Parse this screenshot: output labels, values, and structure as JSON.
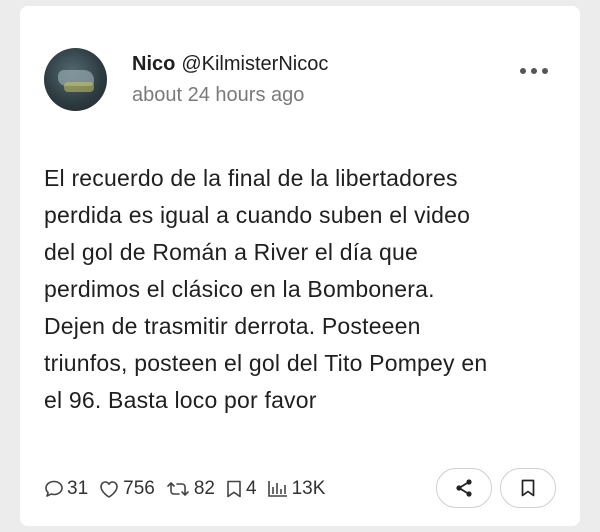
{
  "post": {
    "display_name": "Nico",
    "handle": "@KilmisterNicoc",
    "timestamp": "about 24 hours ago",
    "text_lines": [
      "El recuerdo de la final de la libertadores",
      "perdida es igual a cuando suben el video",
      "del gol de Román a River el día que",
      "perdimos el clásico en la Bombonera.",
      "Dejen de trasmitir derrota. Posteeen",
      "triunfos, posteen el gol del Tito Pompey en",
      "el 96. Basta loco por favor"
    ]
  },
  "stats": {
    "replies": "31",
    "likes": "756",
    "reposts": "82",
    "bookmarks": "4",
    "views": "13K"
  },
  "icons": {
    "replies": "comment-icon",
    "likes": "heart-icon",
    "reposts": "repost-icon",
    "bookmarks": "bookmark-icon",
    "views": "views-chart-icon",
    "share": "share-icon",
    "save": "bookmark-icon",
    "more": "more-horizontal-icon"
  }
}
